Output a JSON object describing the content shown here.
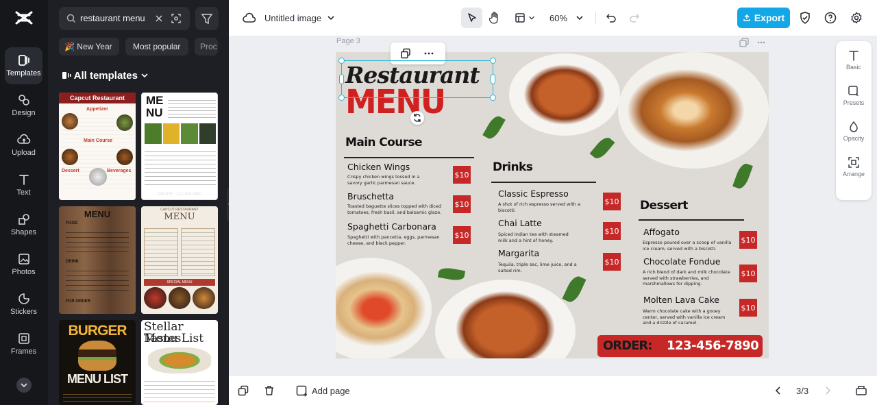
{
  "rail": {
    "items": [
      {
        "label": "Templates",
        "icon": "templates-icon"
      },
      {
        "label": "Design",
        "icon": "design-icon"
      },
      {
        "label": "Upload",
        "icon": "upload-icon"
      },
      {
        "label": "Text",
        "icon": "text-icon"
      },
      {
        "label": "Shapes",
        "icon": "shapes-icon"
      },
      {
        "label": "Photos",
        "icon": "photos-icon"
      },
      {
        "label": "Stickers",
        "icon": "stickers-icon"
      },
      {
        "label": "Frames",
        "icon": "frames-icon"
      }
    ]
  },
  "panel": {
    "search_value": "restaurant menu",
    "chips": [
      "🎉 New Year",
      "Most popular",
      "Proc"
    ],
    "all_templates": "All templates",
    "thumbs": {
      "t1_title": "Capcut Restaurant",
      "t1_sub1": "Appetizer",
      "t1_sub2": "Main Course",
      "t1_sub3": "Dessert",
      "t1_sub4": "Beverages",
      "t2_title1": "ME",
      "t2_title2": "NU",
      "t2_phone": "ORDER : 123-456-7890",
      "t3_title": "MENU",
      "t3_food": "FOOD",
      "t3_drink": "DRINK",
      "t3_order": "FOR ORDER",
      "t4_top": "CAPCUT RESTAURANT",
      "t4_title": "MENU",
      "t4_special": "SPECIAL MENU",
      "t5_title1": "BURGER",
      "t5_title2": "MENU LIST",
      "t6_title1": "Stellar Tastes",
      "t6_title2": "Menu List"
    }
  },
  "topbar": {
    "doc_title": "Untitled image",
    "zoom": "60%",
    "export_label": "Export"
  },
  "canvas": {
    "page_label": "Page 3"
  },
  "poster": {
    "title_script": "Restaurant",
    "title_block": "MENU",
    "main_course": {
      "heading": "Main Course",
      "items": [
        {
          "name": "Chicken Wings",
          "desc": "Crispy chicken wings tossed in a savory garlic parmesan sauce.",
          "price": "$10"
        },
        {
          "name": "Bruschetta",
          "desc": "Toasted baguette slices topped with diced tomatoes, fresh basil, and balsamic glaze.",
          "price": "$10"
        },
        {
          "name": "Spaghetti Carbonara",
          "desc": "Spaghetti with pancetta, eggs, parmesan cheese, and black pepper.",
          "price": "$10"
        }
      ]
    },
    "drinks": {
      "heading": "Drinks",
      "items": [
        {
          "name": "Classic Espresso",
          "desc": "A shot of rich espresso served with a biscotti.",
          "price": "$10"
        },
        {
          "name": "Chai Latte",
          "desc": "Spiced Indian tea with steamed milk and a hint of honey.",
          "price": "$10"
        },
        {
          "name": "Margarita",
          "desc": "Tequila, triple sec, lime juice, and a salted rim.",
          "price": "$10"
        }
      ]
    },
    "dessert": {
      "heading": "Dessert",
      "items": [
        {
          "name": "Affogato",
          "desc": "Espresso poured over a scoop of vanilla ice cream, served with a biscotti.",
          "price": "$10"
        },
        {
          "name": "Chocolate Fondue",
          "desc": "A rich blend of dark and milk chocolate served with strawberries, and marshmallows for dipping.",
          "price": "$10"
        },
        {
          "name": "Molten Lava Cake",
          "desc": "Warm chocolate cake with a gooey center, served with vanilla ice cream and a drizzle of caramel.",
          "price": "$10"
        }
      ]
    },
    "order_label": "ORDER:",
    "order_phone": "123-456-7890"
  },
  "rightpanel": {
    "items": [
      "Basic",
      "Presets",
      "Opacity",
      "Arrange"
    ]
  },
  "bottombar": {
    "add_page": "Add page",
    "page_counter": "3/3"
  },
  "colors": {
    "accent": "#12a7e6",
    "menu_red": "#c62828",
    "selection": "#27b7d6"
  }
}
